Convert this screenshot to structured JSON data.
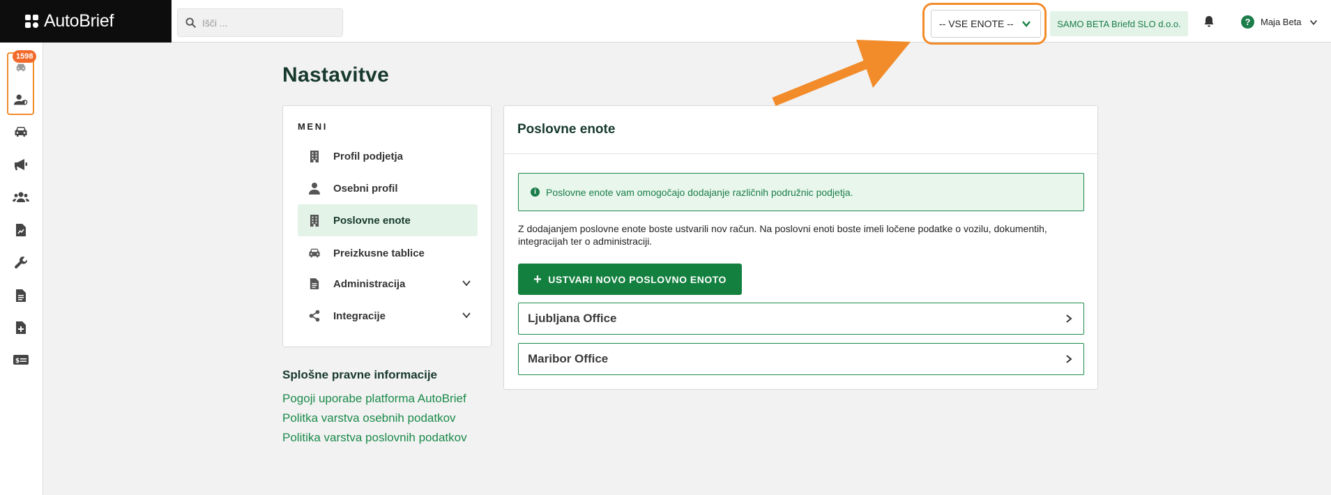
{
  "header": {
    "logo_text": "AutoBrief",
    "search_placeholder": "Išči ...",
    "unit_select": "-- VSE ENOTE --",
    "company": "SAMO BETA Briefd SLO d.o.o.",
    "user_name": "Maja Beta",
    "help_glyph": "?"
  },
  "sidebar": {
    "badge": "1598",
    "items": [
      "car-pair-icon",
      "user-shield-icon",
      "car-icon",
      "megaphone-icon",
      "users-icon",
      "document-chart-icon",
      "wrench-icon",
      "file-text-icon",
      "file-plus-icon",
      "card-icon"
    ]
  },
  "page": {
    "title": "Nastavitve"
  },
  "menu": {
    "heading": "MENI",
    "items": [
      {
        "label": "Profil podjetja",
        "icon": "building-icon"
      },
      {
        "label": "Osebni profil",
        "icon": "user-icon"
      },
      {
        "label": "Poslovne enote",
        "icon": "building-icon"
      },
      {
        "label": "Preizkusne tablice",
        "icon": "car-icon"
      },
      {
        "label": "Administracija",
        "icon": "document-icon"
      },
      {
        "label": "Integracije",
        "icon": "share-icon"
      }
    ]
  },
  "legal": {
    "title": "Splošne pravne informacije",
    "links": [
      "Pogoji uporabe platforma AutoBrief",
      "Politka varstva osebnih podatkov",
      "Politika varstva poslovnih podatkov"
    ]
  },
  "content": {
    "title": "Poslovne enote",
    "info": "Poslovne enote vam omogočajo dodajanje različnih podružnic podjetja.",
    "info_glyph": "i",
    "description": "Z dodajanjem poslovne enote boste ustvarili nov račun. Na poslovni enoti boste imeli ločene podatke o vozilu, dokumentih, integracijah ter o administraciji.",
    "create_button": "USTVARI NOVO POSLOVNO ENOTO",
    "create_plus": "+",
    "units": [
      "Ljubljana Office",
      "Maribor Office"
    ]
  },
  "colors": {
    "accent_green": "#13803f",
    "highlight_orange": "#f28b2a",
    "badge_orange": "#f26a2a"
  }
}
